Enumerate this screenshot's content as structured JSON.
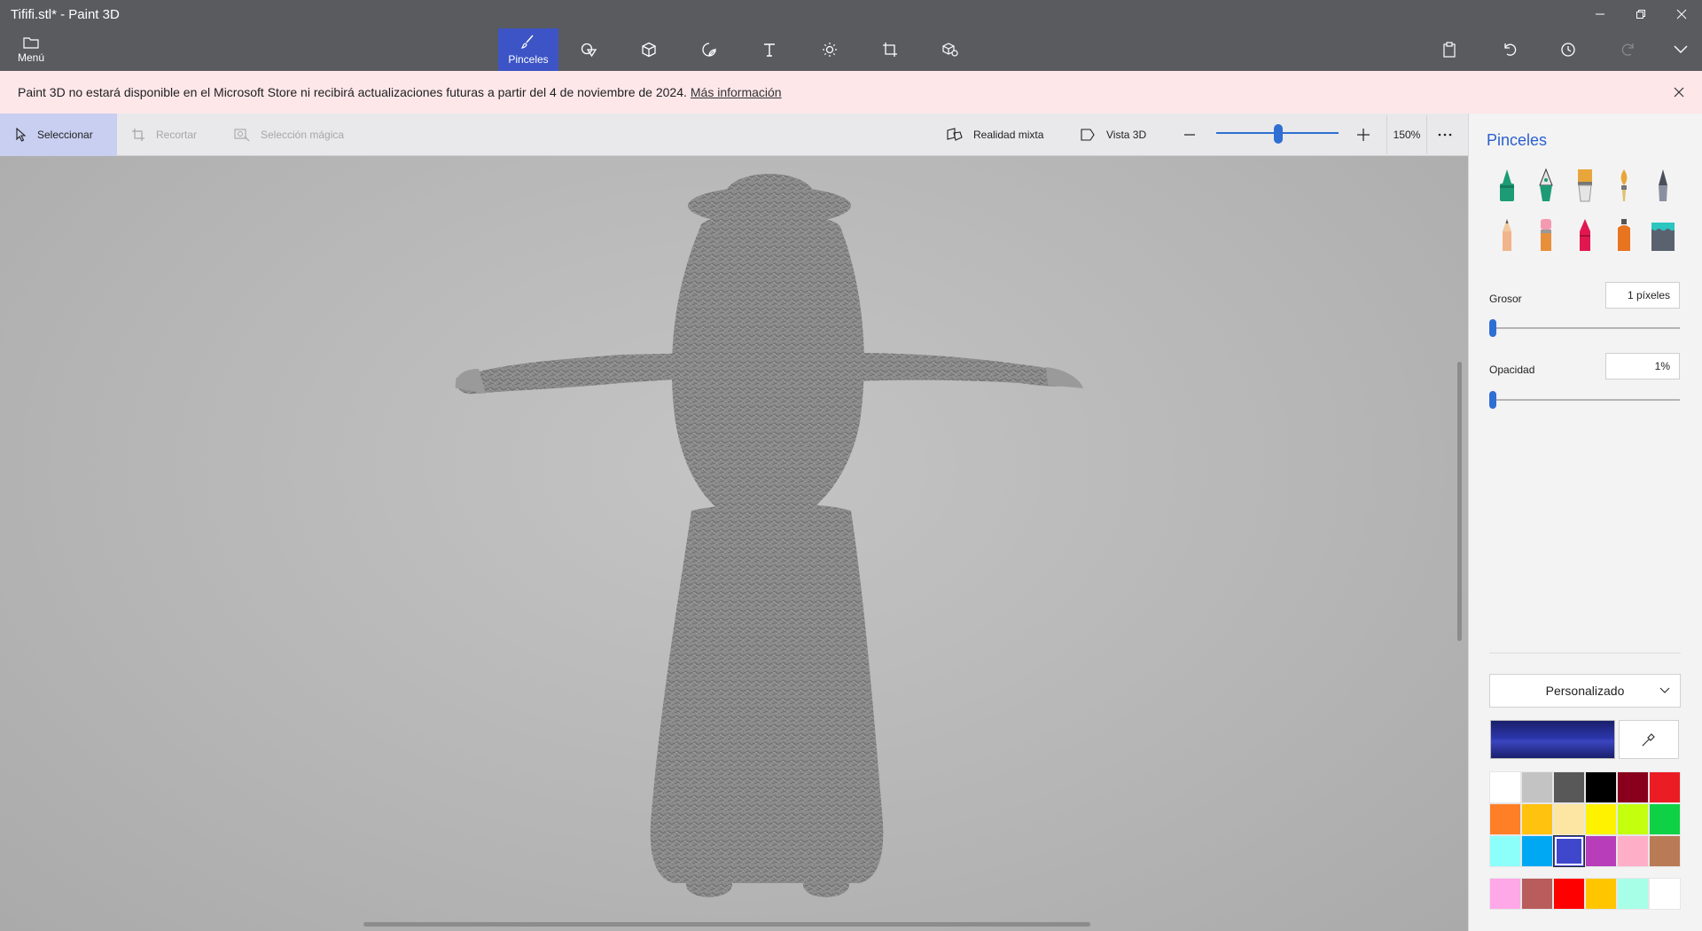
{
  "window": {
    "title": "Tififi.stl* - Paint 3D"
  },
  "menu": {
    "label": "Menú"
  },
  "ribbon": {
    "active_tool_label": "Pinceles",
    "tools": [
      "brush-icon",
      "2d-shapes-icon",
      "3d-shapes-icon",
      "stickers-icon",
      "text-icon",
      "effects-icon",
      "canvas-icon",
      "3d-library-icon"
    ]
  },
  "banner": {
    "message": "Paint 3D no estará disponible en el Microsoft Store ni recibirá actualizaciones futuras a partir del 4 de noviembre de 2024.",
    "link": "Más información"
  },
  "toolbar": {
    "select": "Seleccionar",
    "crop": "Recortar",
    "magic_select": "Selección mágica",
    "mixed_reality": "Realidad mixta",
    "view3d": "Vista 3D",
    "zoom_value": "150%",
    "zoom_fraction": 0.5
  },
  "panel": {
    "title": "Pinceles",
    "thickness_label": "Grosor",
    "thickness_value": "1 píxeles",
    "opacity_label": "Opacidad",
    "opacity_value": "1%",
    "color_mode": "Personalizado"
  },
  "colors": {
    "current": "#2b35a8",
    "row1": [
      "#ffffff",
      "#c3c3c3",
      "#585858",
      "#000000",
      "#88001b",
      "#ec1c24"
    ],
    "row2": [
      "#ff7f27",
      "#ffc20e",
      "#fde6a3",
      "#fff200",
      "#c4ff0e",
      "#0ed145"
    ],
    "row3": [
      "#8cfffb",
      "#00a8f3",
      "#3f48cc",
      "#b83dba",
      "#ffaec8",
      "#b97a56"
    ],
    "custom": [
      "#ffa8e8",
      "#b85c5c",
      "#ff0000",
      "#ffc600",
      "#a8ffe8",
      "#ffffff"
    ]
  }
}
